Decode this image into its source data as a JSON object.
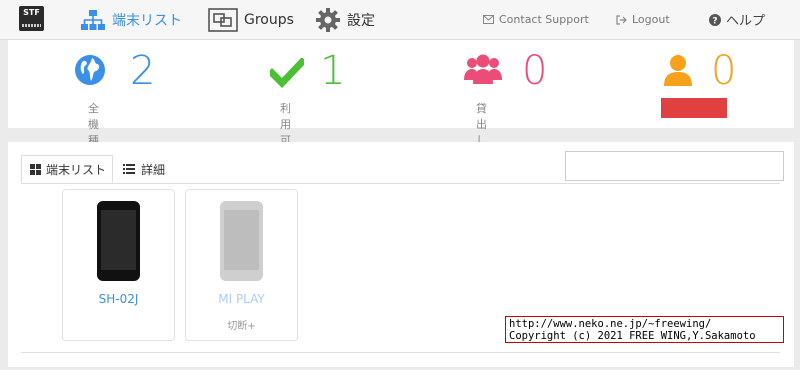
{
  "header": {
    "logo_text": "STF",
    "nav": [
      {
        "label": "端末リスト",
        "icon": "device-tree-icon",
        "active": true
      },
      {
        "label": "Groups",
        "icon": "groups-icon",
        "active": false
      },
      {
        "label": "設定",
        "icon": "gear-icon",
        "active": false
      }
    ],
    "contact_support": "Contact Support",
    "logout": "Logout",
    "help": "ヘルプ"
  },
  "stats": [
    {
      "value": "2",
      "label": "全機種",
      "color": "#3a8fe8",
      "icon": "globe-icon"
    },
    {
      "value": "1",
      "label": "利用可能",
      "color": "#4cbf35",
      "icon": "check-icon"
    },
    {
      "value": "0",
      "label": "貸出し中",
      "color": "#ec4d78",
      "icon": "users-icon"
    },
    {
      "value": "0",
      "label": "",
      "color": "#f5a11c",
      "icon": "user-icon",
      "redacted_color": "#e04040"
    }
  ],
  "tabs": [
    {
      "label": "端末リスト",
      "icon": "grid-icon",
      "active": true
    },
    {
      "label": "詳細",
      "icon": "list-icon",
      "active": false
    }
  ],
  "search": {
    "placeholder": ""
  },
  "devices": [
    {
      "name": "SH-02J",
      "status": "",
      "available": true
    },
    {
      "name": "MI PLAY",
      "status": "切断+",
      "available": false
    }
  ],
  "credit": {
    "line1": "http://www.neko.ne.jp/~freewing/",
    "line2": "Copyright (c) 2021 FREE WING,Y.Sakamoto"
  }
}
